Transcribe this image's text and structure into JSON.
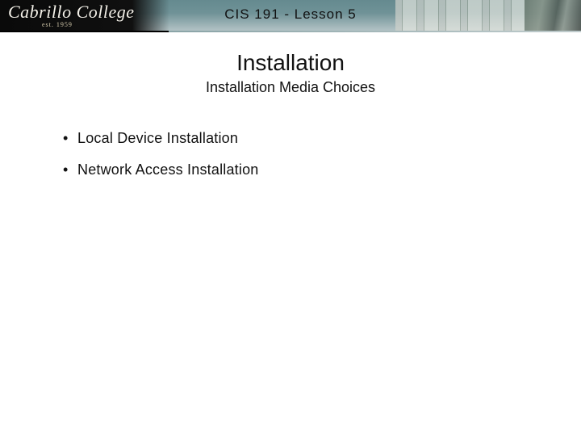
{
  "header": {
    "logo_text": "Cabrillo College",
    "logo_est": "est. 1959",
    "course_label": "CIS 191 - Lesson 5"
  },
  "slide": {
    "title": "Installation",
    "subtitle": "Installation Media Choices",
    "bullets": [
      "Local Device Installation",
      "Network Access Installation"
    ]
  }
}
